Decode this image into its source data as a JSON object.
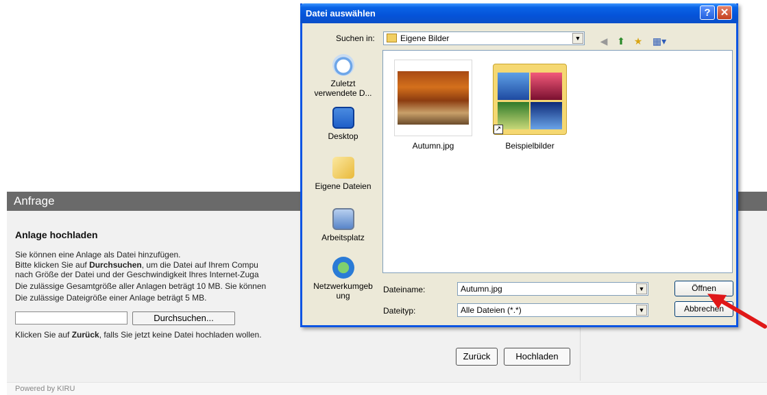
{
  "page": {
    "section_title": "Anfrage",
    "heading": "Anlage hochladen",
    "lines": [
      "Sie können eine Anlage als Datei hinzufügen.",
      "Bitte klicken Sie auf ",
      "nach Größe der Datei und der Geschwindigkeit Ihres Internet-Zuga",
      "Die zulässige Gesamtgröße aller Anlagen beträgt 10 MB. Sie können",
      "Die zulässige Dateigröße einer Anlage beträgt 5 MB."
    ],
    "line2_bold": "Durchsuchen",
    "line2_rest": ", um die Datei auf Ihrem Compu",
    "browse_button": "Durchsuchen...",
    "back_hint_pre": "Klicken Sie auf ",
    "back_hint_bold": "Zurück",
    "back_hint_post": ", falls Sie jetzt keine Datei hochladen wollen.",
    "back_button": "Zurück",
    "upload_button": "Hochladen",
    "footer": "Powered by KIRU"
  },
  "dialog": {
    "title": "Datei auswählen",
    "help_label": "?",
    "close_label": "✕",
    "look_in_label": "Suchen in:",
    "look_in_value": "Eigene Bilder",
    "places": [
      {
        "label": "Zuletzt verwendete D...",
        "icon": "recent-documents-icon"
      },
      {
        "label": "Desktop",
        "icon": "desktop-icon"
      },
      {
        "label": "Eigene Dateien",
        "icon": "my-documents-icon"
      },
      {
        "label": "Arbeitsplatz",
        "icon": "my-computer-icon"
      },
      {
        "label": "Netzwerkumgeb ung",
        "icon": "network-icon"
      }
    ],
    "files": [
      {
        "name": "Autumn.jpg",
        "type": "image"
      },
      {
        "name": "Beispielbilder",
        "type": "folder-shortcut"
      }
    ],
    "filename_label": "Dateiname:",
    "filename_value": "Autumn.jpg",
    "filetype_label": "Dateityp:",
    "filetype_value": "Alle Dateien (*.*)",
    "open_button": "Öffnen",
    "cancel_button": "Abbrechen"
  },
  "colors": {
    "titlebar": "#0553d9",
    "dialog_bg": "#ece9d8",
    "header_bg": "#6a6a6a",
    "annotation_arrow": "#e01818"
  }
}
